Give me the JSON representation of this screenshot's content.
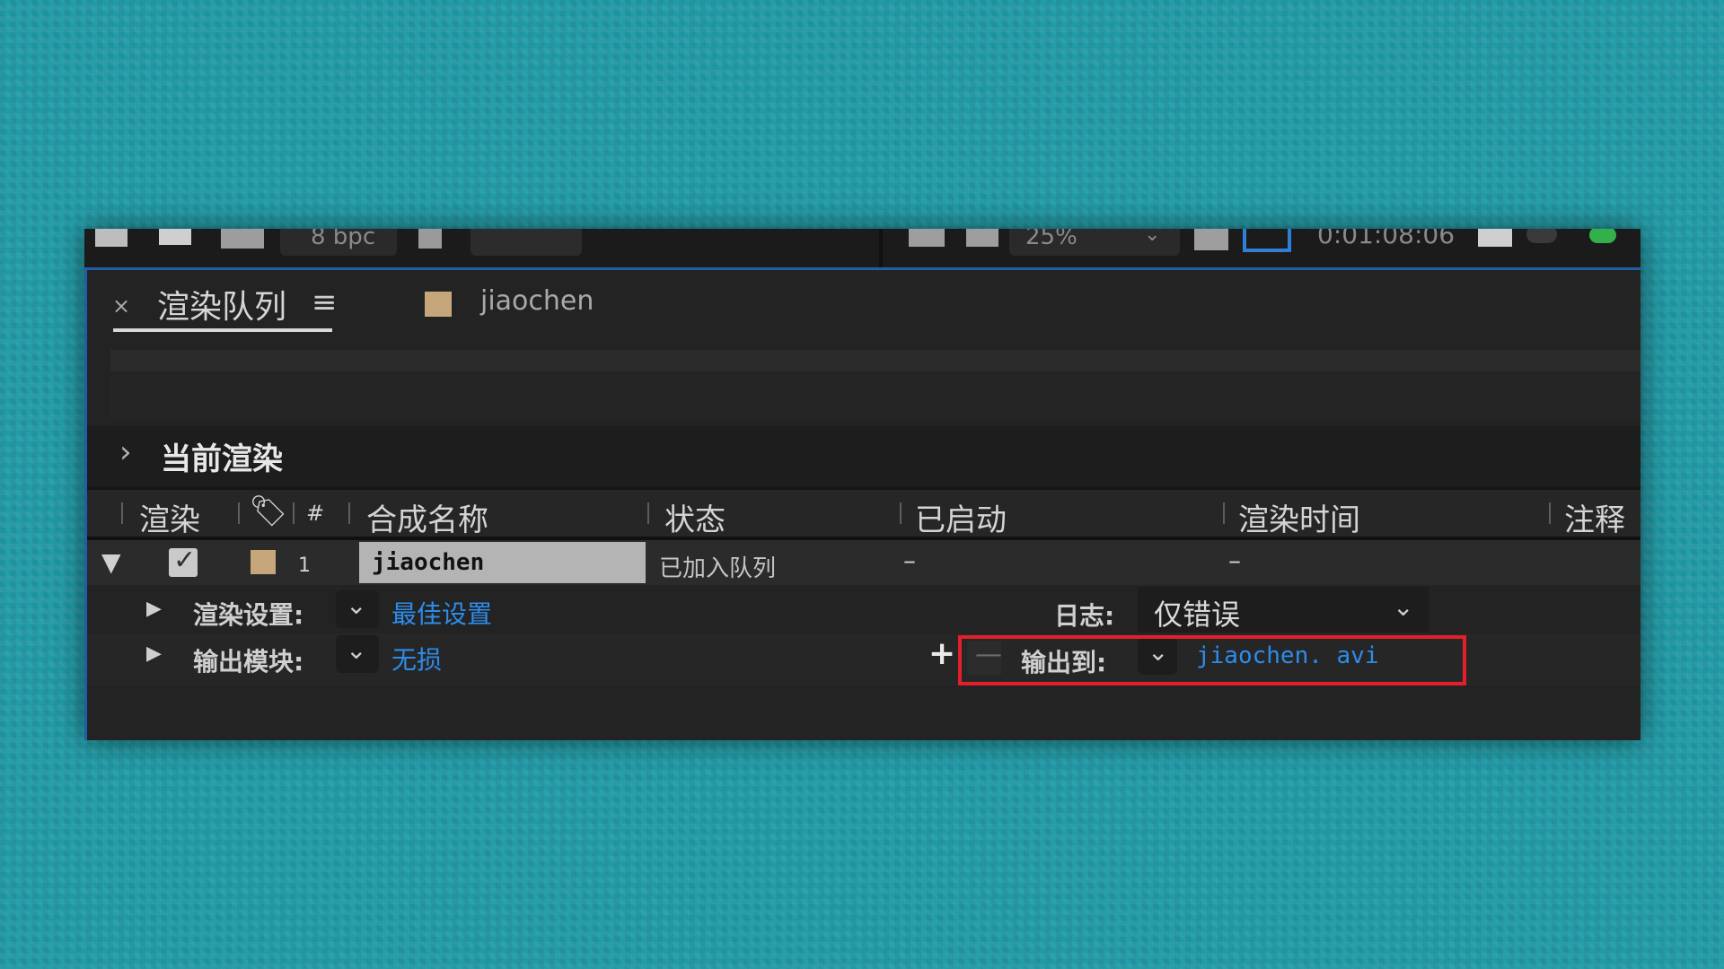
{
  "toolbar": {
    "bpc": "8 bpc",
    "zoom": "25%",
    "timecode": "0:01:08:06"
  },
  "tabs": {
    "close": "×",
    "render_queue": "渲染队列",
    "menu": "≡",
    "comp_tab": "jiaochen",
    "comp_color": "#c6a77b"
  },
  "current_render": {
    "arrow": "›",
    "title": "当前渲染"
  },
  "table": {
    "headers": {
      "render": "渲染",
      "num": "#",
      "comp_name": "合成名称",
      "status": "状态",
      "started": "已启动",
      "render_time": "渲染时间",
      "comment": "注释"
    },
    "rows": [
      {
        "expand": "▼",
        "checked": "✓",
        "num": "1",
        "comp_name": "jiaochen",
        "status": "已加入队列",
        "started": "–",
        "render_time": "–"
      }
    ]
  },
  "render_settings": {
    "label": "渲染设置:",
    "value": "最佳设置",
    "log_label": "日志:",
    "log_value": "仅错误"
  },
  "output_module": {
    "label": "输出模块:",
    "value": "无损",
    "plus": "+",
    "minus": "—",
    "output_to_label": "输出到:",
    "output_file": "jiaochen. avi"
  },
  "colors": {
    "accent_blue": "#2d8ceb",
    "highlight_red": "#e3202a",
    "panel_bg": "#232323"
  }
}
